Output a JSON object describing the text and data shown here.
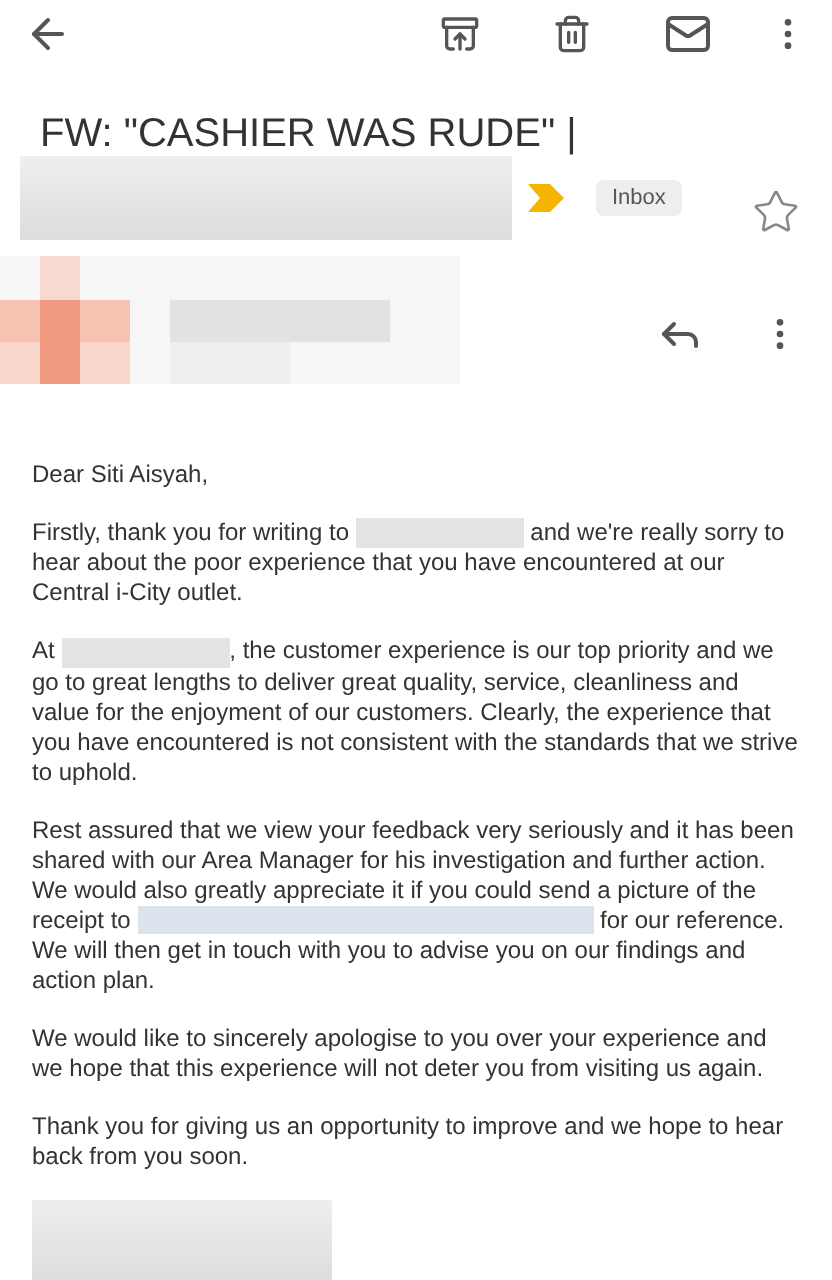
{
  "subject": "FW: \"CASHIER WAS RUDE\" |",
  "label": "Inbox",
  "starred": false,
  "body": [
    {
      "parts": [
        {
          "kind": "text",
          "text": "Dear Siti Aisyah,"
        }
      ]
    },
    {
      "parts": [
        {
          "kind": "text",
          "text": "Firstly, thank you for writing to "
        },
        {
          "kind": "redacted"
        },
        {
          "kind": "text",
          "text": " and we're really sorry to hear about the poor experience that you have encountered at our Central i-City outlet."
        }
      ]
    },
    {
      "parts": [
        {
          "kind": "text",
          "text": "At "
        },
        {
          "kind": "redacted"
        },
        {
          "kind": "text",
          "text": ", the customer experience is our top priority and we go to great lengths to deliver great quality, service, cleanliness and value for the enjoyment of our customers. Clearly, the experience that you have encountered is not consistent with the standards that we strive to uphold."
        }
      ]
    },
    {
      "parts": [
        {
          "kind": "text",
          "text": "Rest assured that we view your feedback very seriously and it has been shared with our Area Manager for his investigation and further action. We would also greatly appreciate it if you could send a picture of the receipt to "
        },
        {
          "kind": "redacted-link"
        },
        {
          "kind": "text",
          "text": " for our reference. We will then get in touch with you to advise you on our findings and action plan."
        }
      ]
    },
    {
      "parts": [
        {
          "kind": "text",
          "text": "We would like to sincerely apologise to you over your experience and we hope that this experience will not deter you from visiting us again."
        }
      ]
    },
    {
      "parts": [
        {
          "kind": "text",
          "text": "Thank you for giving us an opportunity to improve and we hope to hear back from you soon."
        }
      ]
    }
  ]
}
